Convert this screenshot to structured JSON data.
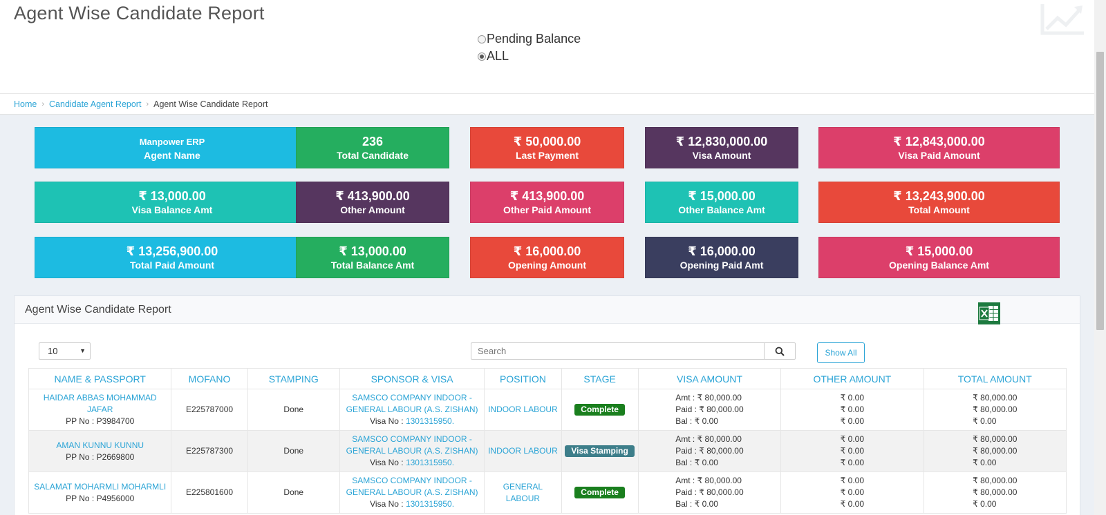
{
  "header": {
    "title": "Agent Wise Candidate Report",
    "filters": [
      {
        "label": "Pending Balance",
        "checked": false
      },
      {
        "label": "ALL",
        "checked": true
      }
    ]
  },
  "breadcrumb": {
    "home": "Home",
    "parent": "Candidate Agent Report",
    "current": "Agent Wise Candidate Report"
  },
  "cards": [
    {
      "value": "Manpower ERP",
      "label": "Agent Name",
      "color": "#1dbbe1"
    },
    {
      "value": "236",
      "label": "Total Candidate",
      "color": "#25ae5f"
    },
    {
      "value": "₹ 50,000.00",
      "label": "Last Payment",
      "color": "#e8493b"
    },
    {
      "value": "₹ 12,830,000.00",
      "label": "Visa Amount",
      "color": "#56365f"
    },
    {
      "value": "₹ 12,843,000.00",
      "label": "Visa Paid Amount",
      "color": "#dc3f6a"
    },
    {
      "value": "₹ 13,000.00",
      "label": "Visa Balance Amt",
      "color": "#1ec2b4"
    },
    {
      "value": "₹ 413,900.00",
      "label": "Other Amount",
      "color": "#56365f"
    },
    {
      "value": "₹ 413,900.00",
      "label": "Other Paid Amount",
      "color": "#dc3f6a"
    },
    {
      "value": "₹ 15,000.00",
      "label": "Other Balance Amt",
      "color": "#1ec2b4"
    },
    {
      "value": "₹ 13,243,900.00",
      "label": "Total Amount",
      "color": "#e8493b"
    },
    {
      "value": "₹ 13,256,900.00",
      "label": "Total Paid Amount",
      "color": "#1dbbe1"
    },
    {
      "value": "₹ 13,000.00",
      "label": "Total Balance Amt",
      "color": "#25ae5f"
    },
    {
      "value": "₹ 16,000.00",
      "label": "Opening Amount",
      "color": "#e8493b"
    },
    {
      "value": "₹ 16,000.00",
      "label": "Opening Paid Amt",
      "color": "#3a3e5f"
    },
    {
      "value": "₹ 15,000.00",
      "label": "Opening Balance Amt",
      "color": "#dc3f6a"
    }
  ],
  "report": {
    "title": "Agent Wise Candidate Report",
    "page_length": "10",
    "search_placeholder": "Search",
    "show_all_label": "Show All",
    "columns": [
      "NAME & PASSPORT",
      "MOFANO",
      "STAMPING",
      "SPONSOR & VISA",
      "POSITION",
      "STAGE",
      "VISA AMOUNT",
      "OTHER AMOUNT",
      "TOTAL AMOUNT"
    ],
    "rows": [
      {
        "name": "HAIDAR ABBAS MOHAMMAD JAFAR",
        "pp_label": "PP No :",
        "pp": "P3984700",
        "mofano": "E225787000",
        "stamping": "Done",
        "sponsor": "SAMSCO COMPANY INDOOR - GENERAL LABOUR (A.S. ZISHAN)",
        "visa_label": "Visa No :",
        "visa_no": "1301315950.",
        "position": "INDOOR LABOUR",
        "stage": "Complete",
        "stage_type": "complete",
        "visa_amt": "Amt : ₹ 80,000.00",
        "visa_paid": "Paid : ₹ 80,000.00",
        "visa_bal": "Bal : ₹ 0.00",
        "other": [
          "₹ 0.00",
          "₹ 0.00",
          "₹ 0.00"
        ],
        "total": [
          "₹ 80,000.00",
          "₹ 80,000.00",
          "₹ 0.00"
        ]
      },
      {
        "name": "AMAN KUNNU KUNNU",
        "pp_label": "PP No :",
        "pp": "P2669800",
        "mofano": "E225787300",
        "stamping": "Done",
        "sponsor": "SAMSCO COMPANY INDOOR - GENERAL LABOUR (A.S. ZISHAN)",
        "visa_label": "Visa No :",
        "visa_no": "1301315950.",
        "position": "INDOOR LABOUR",
        "stage": "Visa Stamping",
        "stage_type": "stamping",
        "visa_amt": "Amt : ₹ 80,000.00",
        "visa_paid": "Paid : ₹ 80,000.00",
        "visa_bal": "Bal : ₹ 0.00",
        "other": [
          "₹ 0.00",
          "₹ 0.00",
          "₹ 0.00"
        ],
        "total": [
          "₹ 80,000.00",
          "₹ 80,000.00",
          "₹ 0.00"
        ]
      },
      {
        "name": "SALAMAT MOHARMLI MOHARMLI",
        "pp_label": "PP No :",
        "pp": "P4956000",
        "mofano": "E225801600",
        "stamping": "Done",
        "sponsor": "SAMSCO COMPANY INDOOR - GENERAL LABOUR (A.S. ZISHAN)",
        "visa_label": "Visa No :",
        "visa_no": "1301315950.",
        "position": "GENERAL LABOUR",
        "stage": "Complete",
        "stage_type": "complete",
        "visa_amt": "Amt : ₹ 80,000.00",
        "visa_paid": "Paid : ₹ 80,000.00",
        "visa_bal": "Bal : ₹ 0.00",
        "other": [
          "₹ 0.00",
          "₹ 0.00",
          "₹ 0.00"
        ],
        "total": [
          "₹ 80,000.00",
          "₹ 80,000.00",
          "₹ 0.00"
        ]
      }
    ]
  },
  "icons": {
    "trend": "trend-chart-icon",
    "excel": "excel-export-icon",
    "search": "search-icon"
  }
}
